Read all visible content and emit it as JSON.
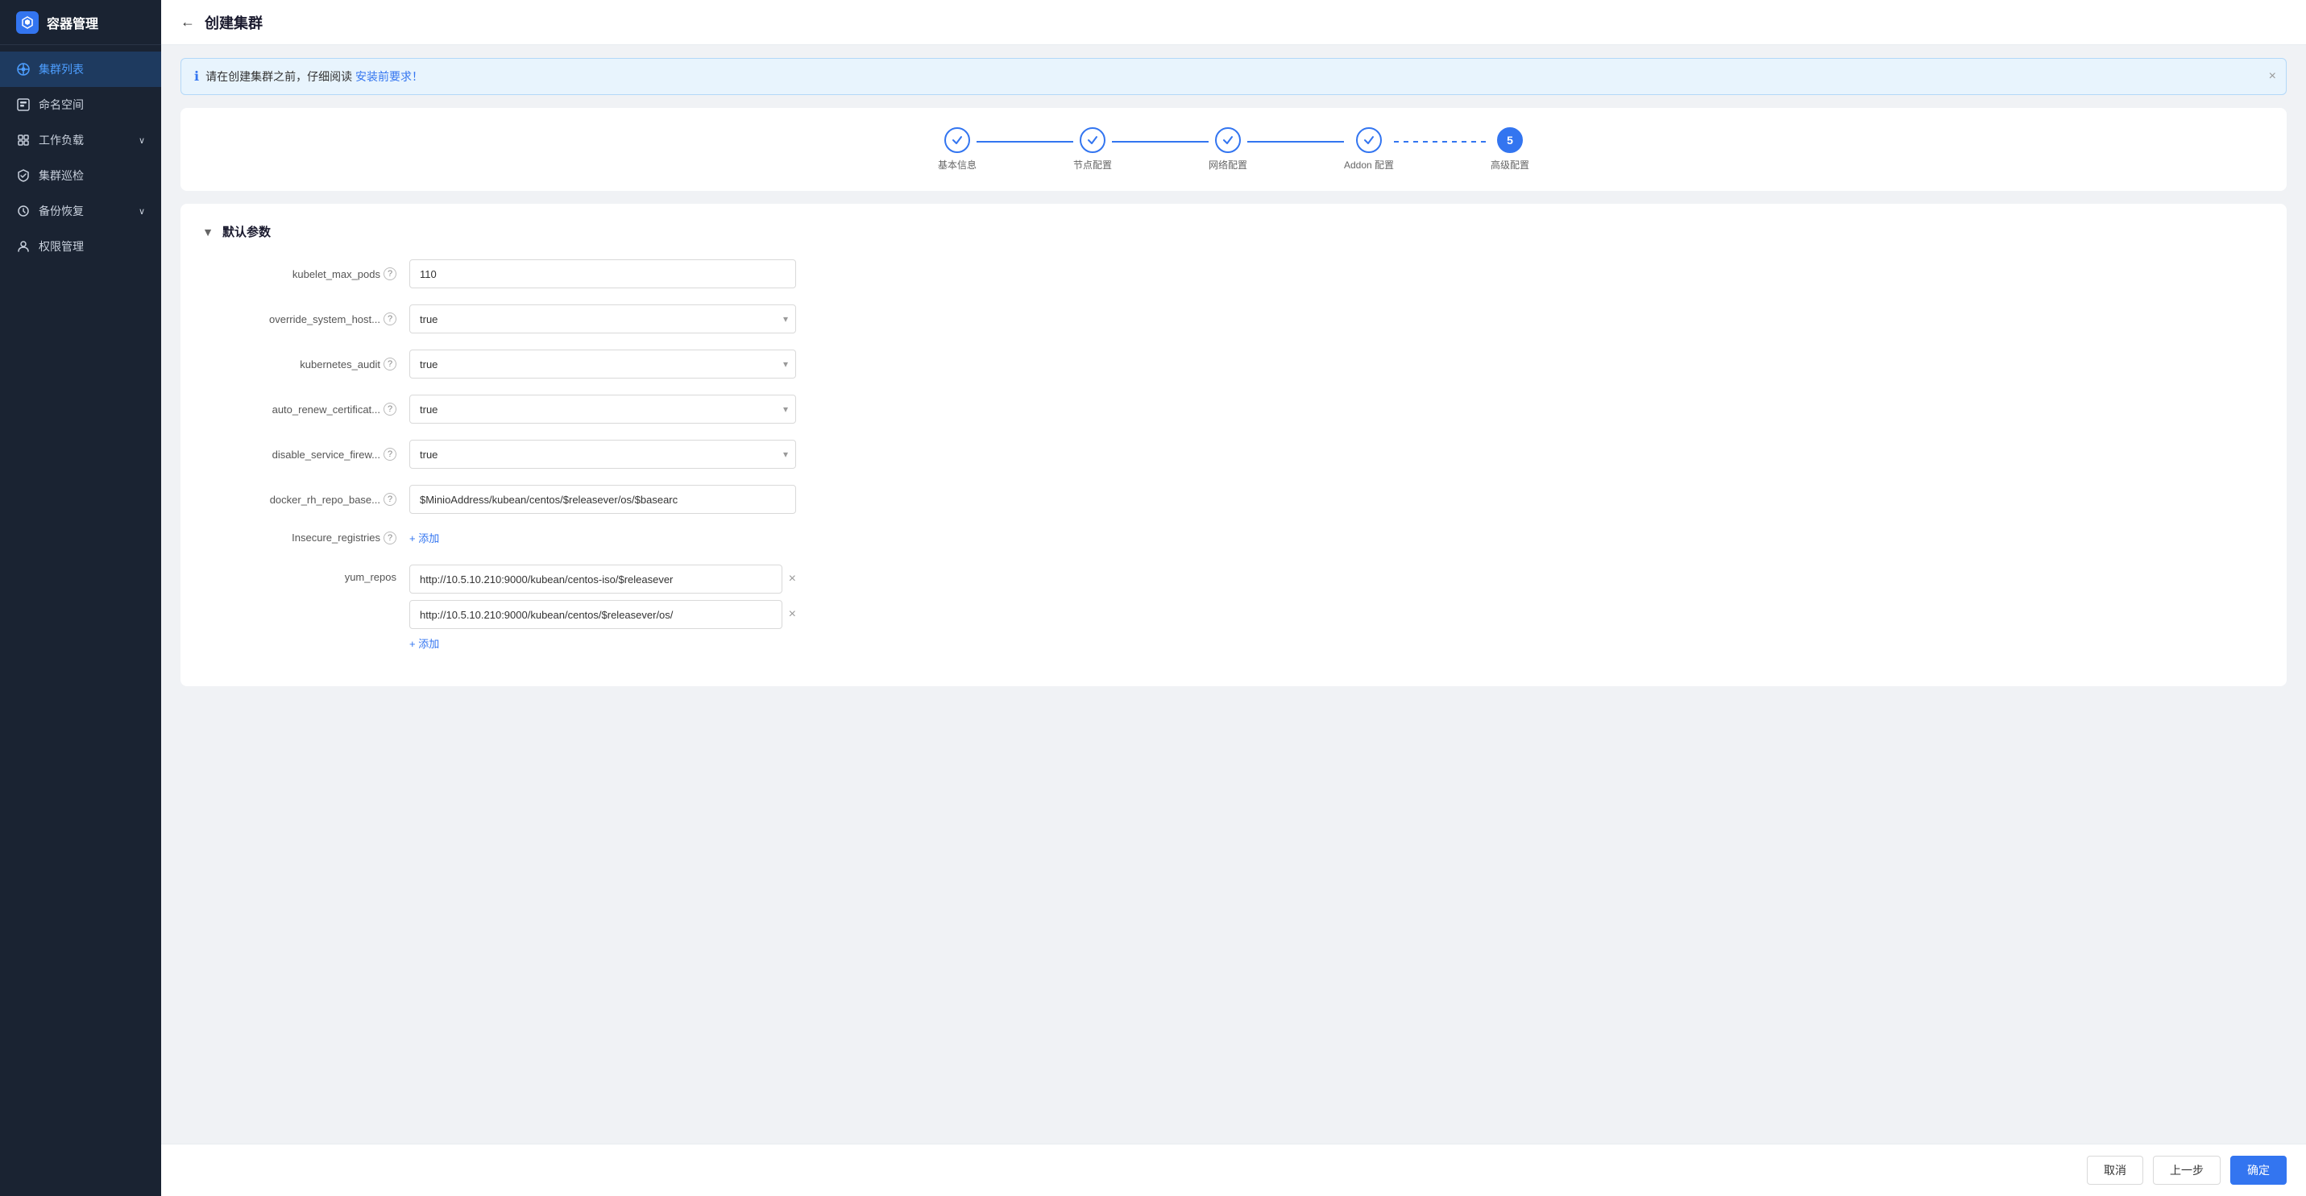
{
  "app": {
    "logo_text": "容器管理",
    "logo_icon": "⬡"
  },
  "sidebar": {
    "items": [
      {
        "id": "cluster-list",
        "label": "集群列表",
        "icon": "cluster",
        "active": true
      },
      {
        "id": "namespace",
        "label": "命名空间",
        "icon": "namespace",
        "active": false
      },
      {
        "id": "workload",
        "label": "工作负载",
        "icon": "workload",
        "active": false,
        "has_arrow": true
      },
      {
        "id": "patrol",
        "label": "集群巡检",
        "icon": "patrol",
        "active": false
      },
      {
        "id": "backup",
        "label": "备份恢复",
        "icon": "backup",
        "active": false,
        "has_arrow": true
      },
      {
        "id": "permission",
        "label": "权限管理",
        "icon": "permission",
        "active": false
      }
    ]
  },
  "header": {
    "back_icon": "←",
    "title": "创建集群"
  },
  "banner": {
    "text": "请在创建集群之前，仔细阅读 ",
    "link_text": "安装前要求！",
    "close_icon": "×"
  },
  "stepper": {
    "steps": [
      {
        "id": 1,
        "label": "基本信息",
        "status": "done"
      },
      {
        "id": 2,
        "label": "节点配置",
        "status": "done"
      },
      {
        "id": 3,
        "label": "网络配置",
        "status": "done"
      },
      {
        "id": 4,
        "label": "Addon 配置",
        "status": "done"
      },
      {
        "id": 5,
        "label": "高级配置",
        "status": "active"
      }
    ]
  },
  "form": {
    "section_title": "默认参数",
    "collapse_icon": "▼",
    "fields": [
      {
        "id": "kubelet_max_pods",
        "label": "kubelet_max_pods",
        "type": "input",
        "value": "110",
        "has_help": true
      },
      {
        "id": "override_system_host",
        "label": "override_system_host...",
        "type": "select",
        "value": "true",
        "options": [
          "true",
          "false"
        ],
        "has_help": true
      },
      {
        "id": "kubernetes_audit",
        "label": "kubernetes_audit",
        "type": "select",
        "value": "true",
        "options": [
          "true",
          "false"
        ],
        "has_help": true
      },
      {
        "id": "auto_renew_certificat",
        "label": "auto_renew_certificat...",
        "type": "select",
        "value": "true",
        "options": [
          "true",
          "false"
        ],
        "has_help": true
      },
      {
        "id": "disable_service_firew",
        "label": "disable_service_firew...",
        "type": "select",
        "value": "true",
        "options": [
          "true",
          "false"
        ],
        "has_help": true
      },
      {
        "id": "docker_rh_repo_base",
        "label": "docker_rh_repo_base...",
        "type": "input",
        "value": "$MinioAddress/kubean/centos/$releasever/os/$basearc",
        "has_help": true
      },
      {
        "id": "insecure_registries",
        "label": "Insecure_registries",
        "type": "add",
        "add_label": "+ 添加",
        "has_help": true
      },
      {
        "id": "yum_repos",
        "label": "yum_repos",
        "type": "multi-input",
        "values": [
          "http://10.5.10.210:9000/kubean/centos-iso/$releasever",
          "http://10.5.10.210:9000/kubean/centos/$releasever/os/"
        ],
        "add_label": "+ 添加",
        "has_help": false
      }
    ]
  },
  "footer": {
    "cancel_label": "取消",
    "prev_label": "上一步",
    "confirm_label": "确定"
  }
}
